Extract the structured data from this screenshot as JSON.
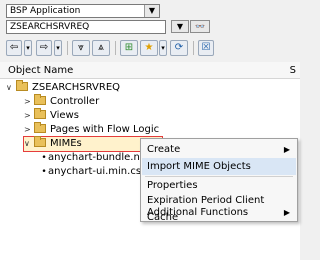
{
  "selector": {
    "application_type": "BSP Application",
    "object_name": "ZSEARCHSRVREQ"
  },
  "toolbar": {
    "back_icon": "arrow-left-icon",
    "forward_icon": "arrow-right-icon",
    "expand_icon": "expand-icon",
    "collapse_icon": "collapse-icon",
    "favorites_icon": "favorites-icon",
    "refresh_icon": "refresh-icon",
    "close_icon": "close-icon"
  },
  "tree": {
    "column_header": "Object Name",
    "column_header_right": "S",
    "nodes": [
      {
        "label": "ZSEARCHSRVREQ",
        "level": 0,
        "type": "folder",
        "state": "expanded"
      },
      {
        "label": "Controller",
        "level": 1,
        "type": "folder",
        "state": "collapsed"
      },
      {
        "label": "Views",
        "level": 1,
        "type": "folder",
        "state": "collapsed"
      },
      {
        "label": "Pages with Flow Logic",
        "level": 1,
        "type": "folder",
        "state": "collapsed"
      },
      {
        "label": "MIMEs",
        "level": 1,
        "type": "folder",
        "state": "expanded",
        "selected": true
      },
      {
        "label": "anychart-bundle.n",
        "level": 2,
        "type": "file"
      },
      {
        "label": "anychart-ui.min.cs",
        "level": 2,
        "type": "file"
      }
    ]
  },
  "context_menu": {
    "items": [
      {
        "label": "Create",
        "submenu": true
      },
      {
        "label": "Import MIME Objects",
        "highlighted": true
      },
      {
        "label": "Properties"
      },
      {
        "label": "Expiration Period Client Cache"
      },
      {
        "label": "Additional Functions",
        "submenu": true
      }
    ]
  }
}
